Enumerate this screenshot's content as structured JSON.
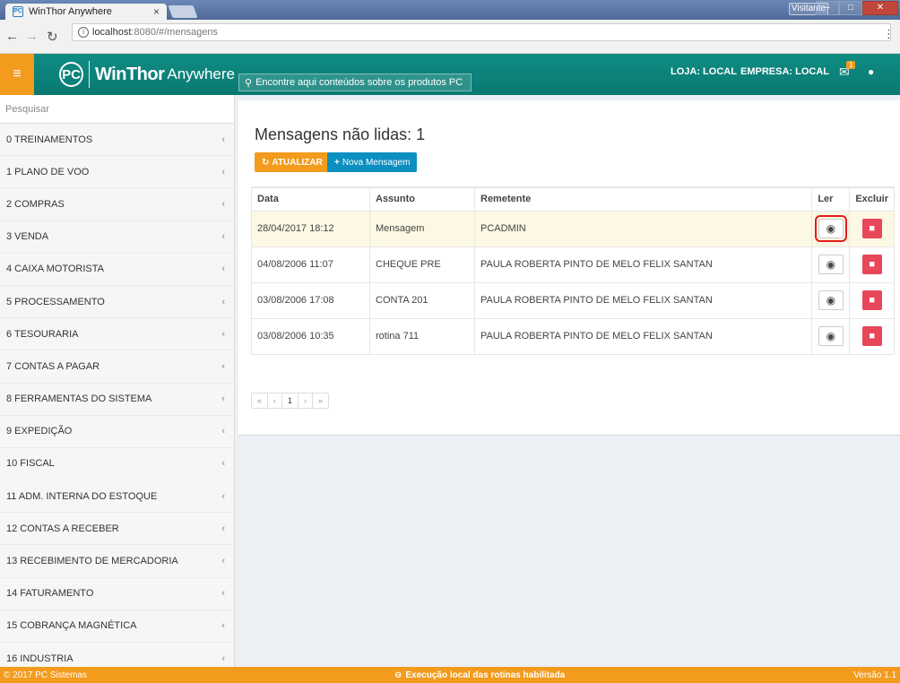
{
  "browser": {
    "tab_title": "WinThor Anywhere",
    "tab_favicon": "PC",
    "tab_close": "×",
    "window_user": "Visitante",
    "url_host": "localhost",
    "url_path": ":8080/#/mensagens"
  },
  "header": {
    "menu_icon": "≡",
    "logo_mark": "PC",
    "brand": "WinThor",
    "brand_sub": "Anywhere",
    "search_placeholder": "Encontre aqui conteúdos sobre os produtos PC",
    "store": "LOJA: LOCAL",
    "company": "EMPRESA: LOCAL",
    "mail_badge": "1",
    "brand_color": "#0f8c83",
    "accent_color": "#f29b1d"
  },
  "sidebar": {
    "search_placeholder": "Pesquisar",
    "items": [
      {
        "label": "0  TREINAMENTOS"
      },
      {
        "label": "1  PLANO DE VOO"
      },
      {
        "label": "2  COMPRAS"
      },
      {
        "label": "3  VENDA"
      },
      {
        "label": "4  CAIXA MOTORISTA"
      },
      {
        "label": "5  PROCESSAMENTO"
      },
      {
        "label": "6  TESOURARIA"
      },
      {
        "label": "7  CONTAS A PAGAR"
      },
      {
        "label": "8  FERRAMENTAS DO SISTEMA"
      },
      {
        "label": "9  EXPEDIÇÃO"
      },
      {
        "label": "10  FISCAL"
      },
      {
        "label": "11  ADM. INTERNA DO ESTOQUE"
      },
      {
        "label": "12  CONTAS A RECEBER"
      },
      {
        "label": "13  RECEBIMENTO DE MERCADORIA"
      },
      {
        "label": "14  FATURAMENTO"
      },
      {
        "label": "15  COBRANÇA MAGNÉTICA"
      },
      {
        "label": "16  INDUSTRIA"
      }
    ]
  },
  "main": {
    "title": "Mensagens não lidas: 1",
    "refresh_label": "ATUALIZAR",
    "new_message_label": "Nova Mensagem",
    "columns": {
      "date": "Data",
      "subject": "Assunto",
      "sender": "Remetente",
      "read": "Ler",
      "delete": "Excluir"
    },
    "rows": [
      {
        "date": "28/04/2017 18:12",
        "subject": "Mensagem",
        "sender": "PCADMIN",
        "unread": true
      },
      {
        "date": "04/08/2006 11:07",
        "subject": "CHEQUE PRE",
        "sender": "PAULA ROBERTA PINTO DE MELO FELIX SANTAN",
        "unread": false
      },
      {
        "date": "03/08/2006 17:08",
        "subject": "CONTA 201",
        "sender": "PAULA ROBERTA PINTO DE MELO FELIX SANTAN",
        "unread": false
      },
      {
        "date": "03/08/2006 10:35",
        "subject": "rotina 711",
        "sender": "PAULA ROBERTA PINTO DE MELO FELIX SANTAN",
        "unread": false
      }
    ],
    "pagination": {
      "first": "«",
      "prev": "‹",
      "current": "1",
      "next": "›",
      "last": "»"
    }
  },
  "footer": {
    "copyright": "© 2017 PC Sistemas",
    "status": "Execução local das rotinas habilitada",
    "version": "Versão 1.1"
  }
}
